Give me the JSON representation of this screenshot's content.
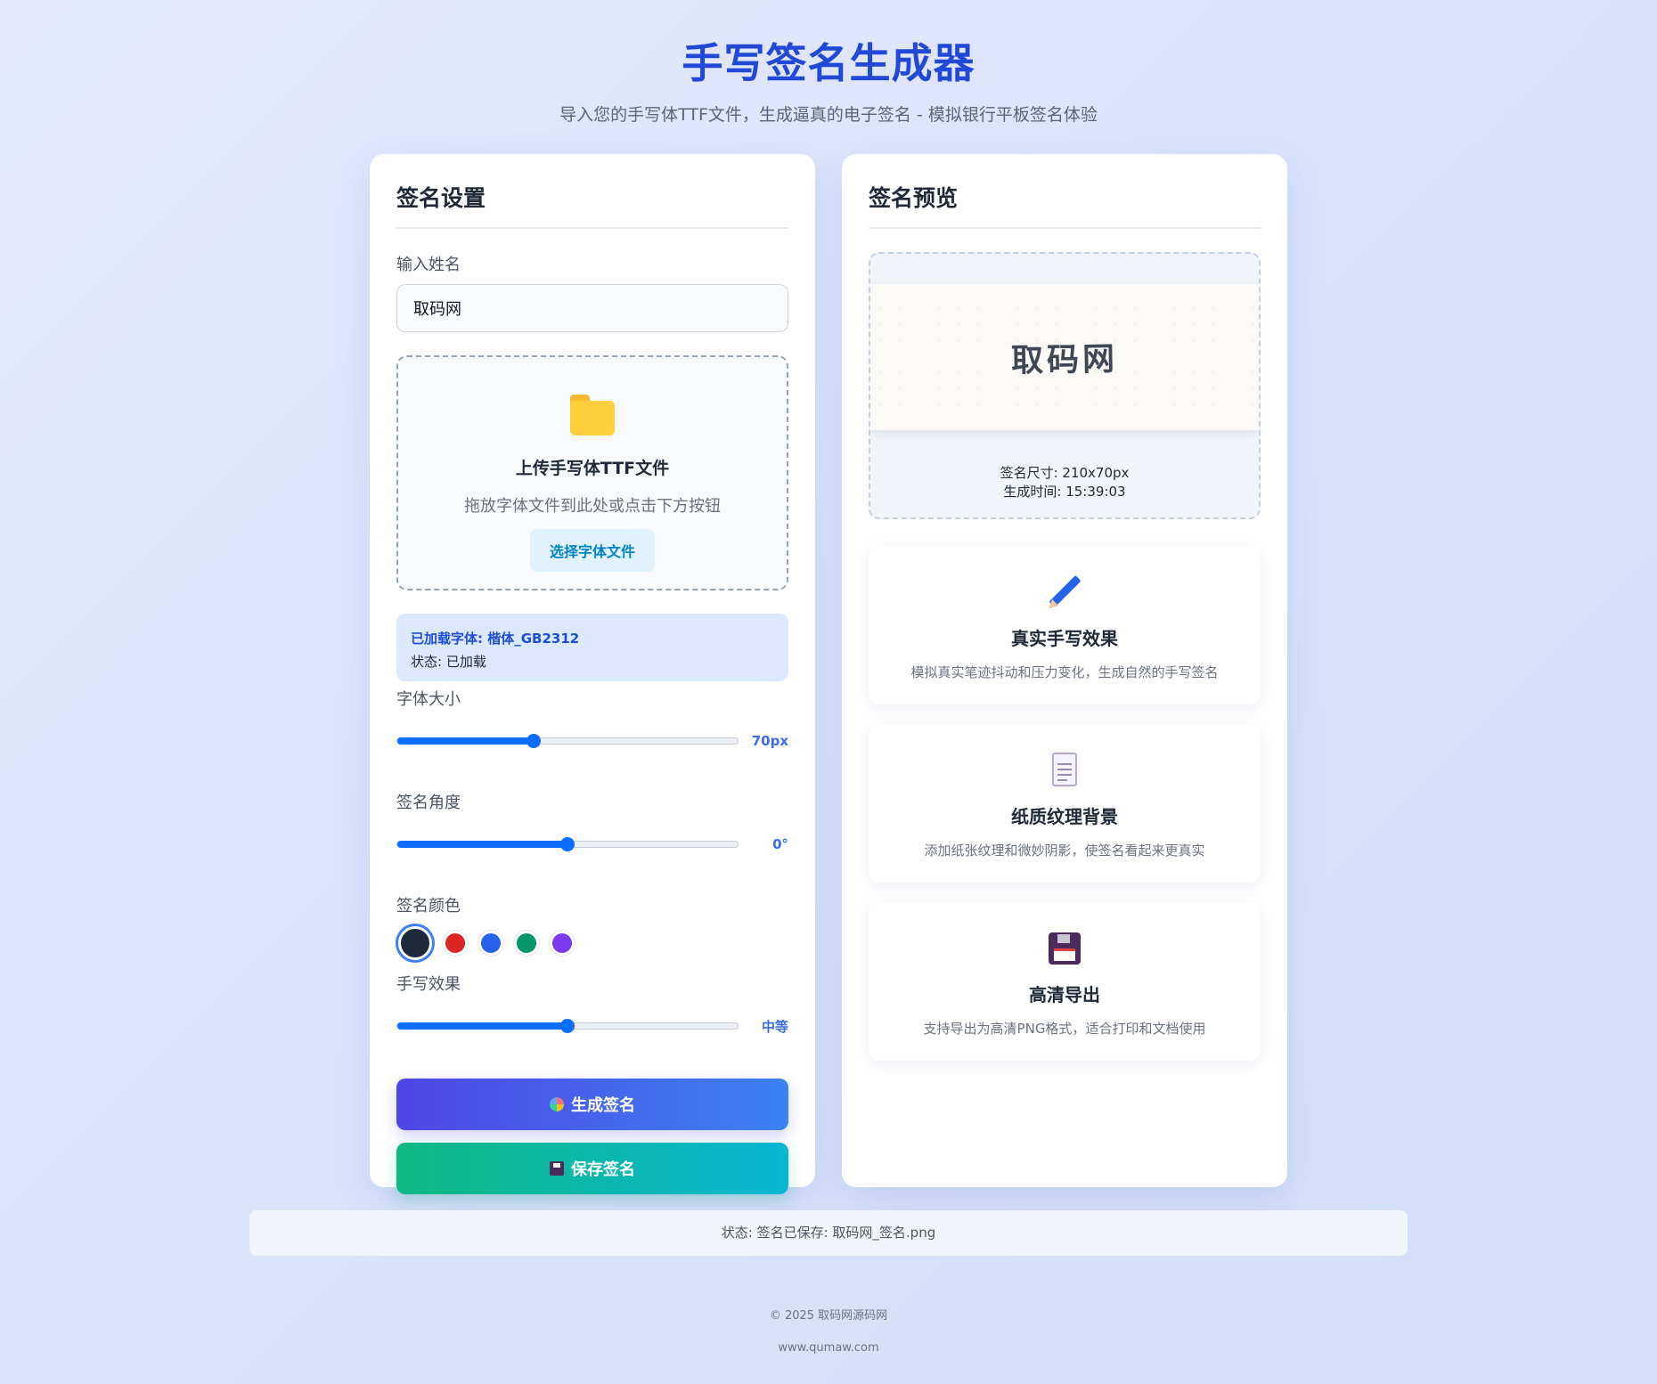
{
  "header": {
    "title": "手写签名生成器",
    "subtitle": "导入您的手写体TTF文件，生成逼真的电子签名 - 模拟银行平板签名体验"
  },
  "settings": {
    "title": "签名设置",
    "name_label": "输入姓名",
    "name_value": "取码网",
    "upload": {
      "icon": "folder-icon",
      "title": "上传手写体TTF文件",
      "desc": "拖放字体文件到此处或点击下方按钮",
      "button_label": "选择字体文件"
    },
    "font_info": {
      "loaded_label": "已加载字体: 楷体_GB2312",
      "status_label": "状态: 已加载"
    },
    "font_size": {
      "label": "字体大小",
      "value_label": "70px",
      "fraction": 0.4
    },
    "angle": {
      "label": "签名角度",
      "value_label": "0°",
      "fraction": 0.5
    },
    "color": {
      "label": "签名颜色",
      "options": [
        "#1e293b",
        "#dc2626",
        "#2563eb",
        "#059669",
        "#7c3aed"
      ],
      "selected_index": 0
    },
    "effect": {
      "label": "手写效果",
      "value_label": "中等",
      "fraction": 0.5
    },
    "generate_label": "生成签名",
    "save_label": "保存签名"
  },
  "preview": {
    "title": "签名预览",
    "signature_text": "取码网",
    "size_label": "签名尺寸: 210x70px",
    "time_label": "生成时间: 15:39:03"
  },
  "features": [
    {
      "icon": "pencil-icon",
      "title": "真实手写效果",
      "desc": "模拟真实笔迹抖动和压力变化，生成自然的手写签名"
    },
    {
      "icon": "document-icon",
      "title": "纸质纹理背景",
      "desc": "添加纸张纹理和微妙阴影，使签名看起来更真实"
    },
    {
      "icon": "floppy-disk-icon",
      "title": "高清导出",
      "desc": "支持导出为高清PNG格式，适合打印和文档使用"
    }
  ],
  "status_bar": "状态: 签名已保存: 取码网_签名.png",
  "footer": {
    "copyright": "© 2025 取码网源码网",
    "url": "www.qumaw.com"
  },
  "colors": {
    "accent": "#2148d6",
    "slider": "#0d6efd"
  }
}
